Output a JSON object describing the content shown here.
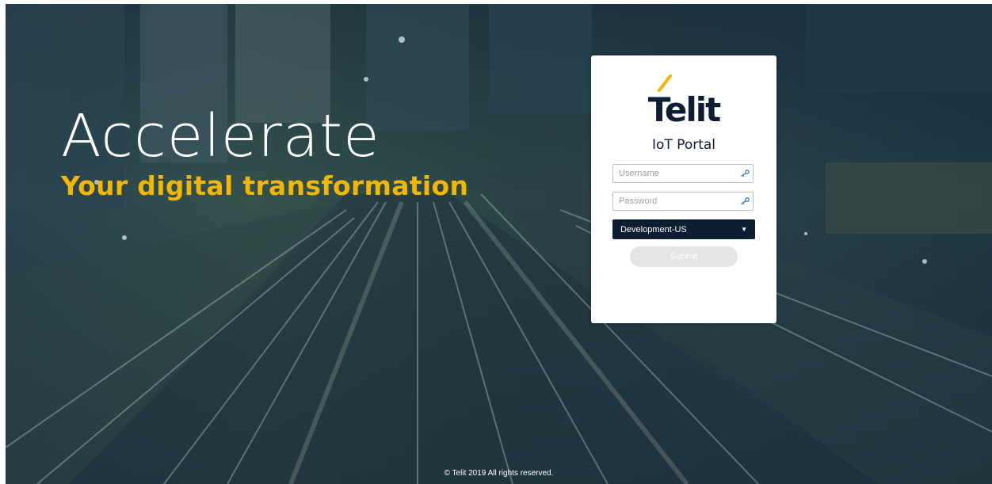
{
  "hero": {
    "headline": "Accelerate",
    "subheadline": "Your digital transformation"
  },
  "login": {
    "brand_name": "Telit",
    "portal_title": "IoT Portal",
    "username_placeholder": "Username",
    "password_placeholder": "Password",
    "environment_selected": "Development-US",
    "submit_label": "Submit"
  },
  "footer": {
    "copyright": "© Telit 2019 All rights reserved."
  },
  "colors": {
    "accent_yellow": "#f2b705",
    "brand_navy": "#0d1d33",
    "submit_disabled": "#e4e4e4"
  }
}
